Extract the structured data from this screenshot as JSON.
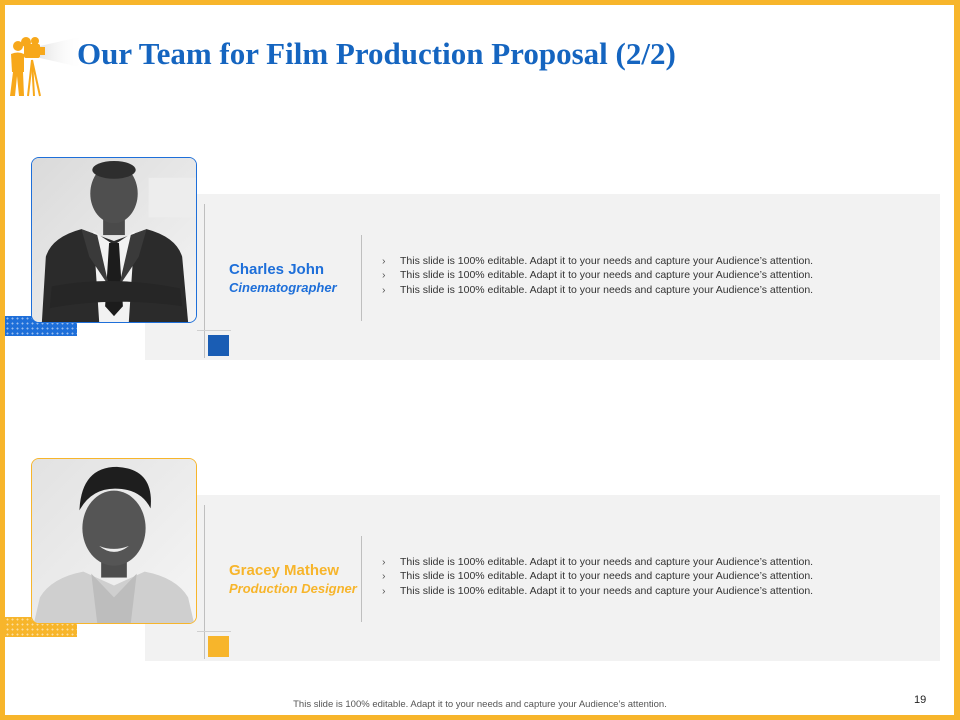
{
  "slide": {
    "title": "Our Team for Film Production Proposal (2/2)",
    "footer": "This slide is 100% editable. Adapt it to your needs and capture your Audience’s attention.",
    "page_number": "19"
  },
  "members": [
    {
      "name": "Charles John",
      "role": "Cinematographer",
      "bullets": [
        "This slide is 100% editable. Adapt it to your needs and capture your Audience’s attention.",
        "This slide is 100% editable. Adapt it to your needs and capture your Audience’s attention.",
        "This slide is 100% editable. Adapt it to your needs and capture your Audience’s attention."
      ]
    },
    {
      "name": "Gracey Mathew",
      "role": "Production Designer",
      "bullets": [
        "This slide is 100% editable. Adapt it to your needs and capture your Audience’s attention.",
        "This slide is 100% editable. Adapt it to your needs and capture your Audience’s attention.",
        "This slide is 100% editable. Adapt it to your needs and capture your Audience’s attention."
      ]
    }
  ],
  "icons": {
    "header": "film-camera-operator-icon"
  },
  "colors": {
    "accent_orange": "#F7B52B",
    "accent_blue": "#1E6FD9",
    "title_blue": "#1565C0",
    "panel_gray": "#F2F2F2"
  }
}
